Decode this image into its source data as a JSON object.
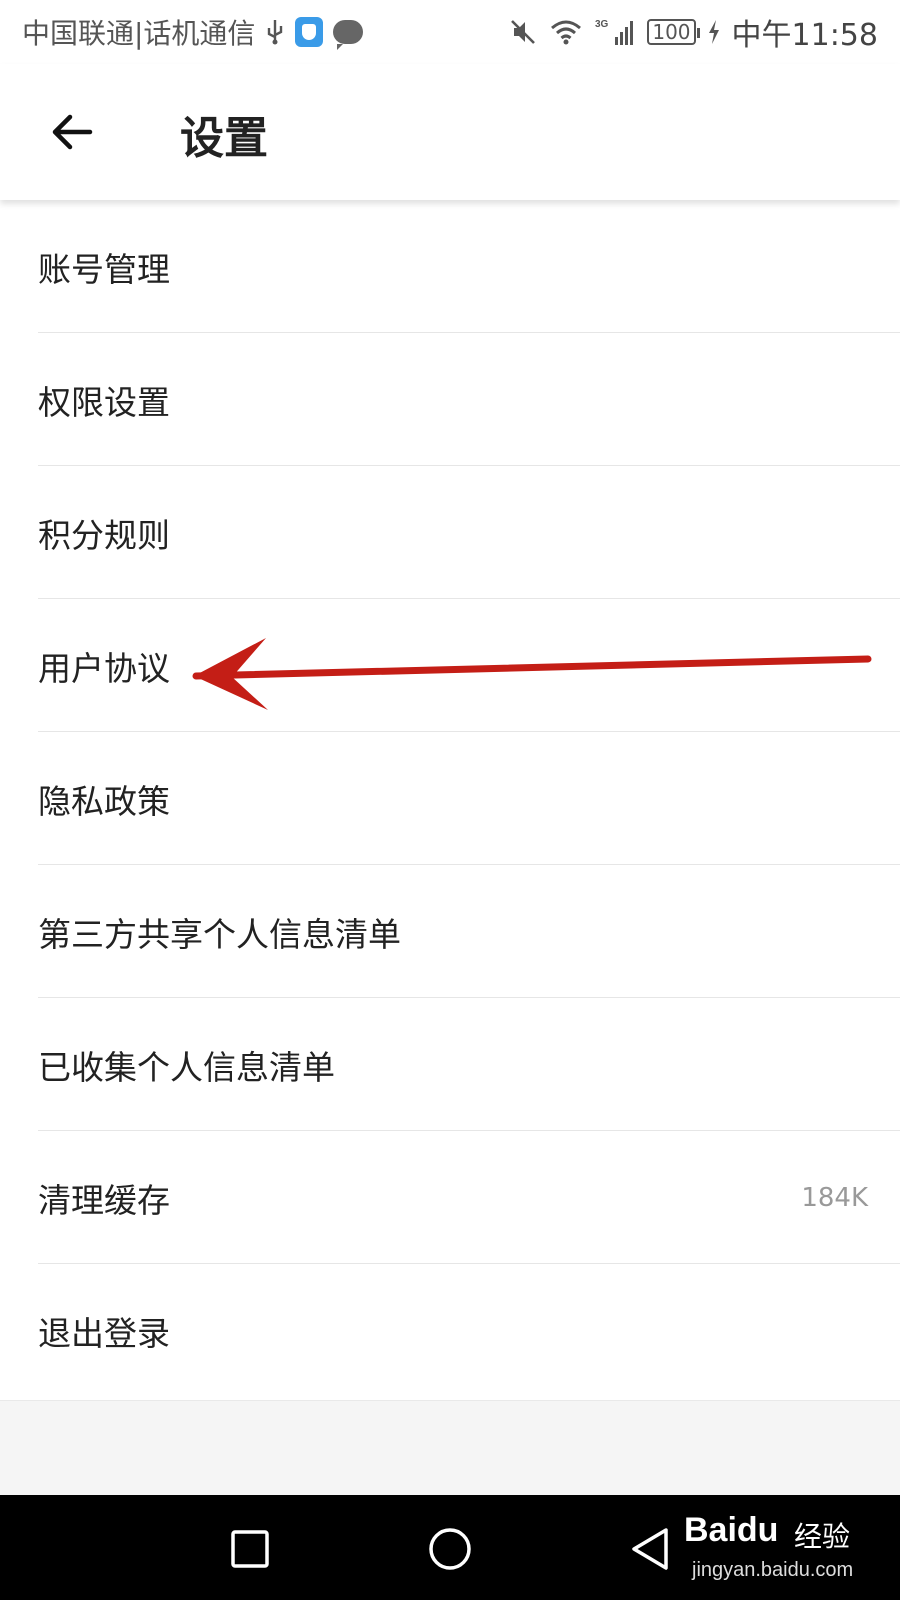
{
  "status_bar": {
    "carrier": "中国联通|话机通信",
    "network_label": "3G",
    "battery": "100",
    "time": "中午11:58",
    "icons": [
      "usb-icon",
      "shield-app-icon",
      "chat-icon",
      "mute-icon",
      "wifi-icon",
      "signal-icon",
      "battery-icon",
      "charging-icon"
    ]
  },
  "header": {
    "title": "设置",
    "back_icon": "arrow-left-icon"
  },
  "settings": {
    "items": [
      {
        "label": "账号管理",
        "value": ""
      },
      {
        "label": "权限设置",
        "value": ""
      },
      {
        "label": "积分规则",
        "value": ""
      },
      {
        "label": "用户协议",
        "value": ""
      },
      {
        "label": "隐私政策",
        "value": ""
      },
      {
        "label": "第三方共享个人信息清单",
        "value": ""
      },
      {
        "label": "已收集个人信息清单",
        "value": ""
      },
      {
        "label": "清理缓存",
        "value": "184K"
      },
      {
        "label": "退出登录",
        "value": ""
      }
    ]
  },
  "annotation": {
    "color": "#c41e16",
    "points_to": "用户协议"
  },
  "nav_bar": {
    "icons": [
      "recent-apps-icon",
      "home-icon",
      "back-triangle-icon"
    ]
  },
  "watermark": {
    "logo": "Baidu",
    "brand": "经验",
    "url": "jingyan.baidu.com"
  },
  "colors": {
    "background": "#ffffff",
    "text": "#222222",
    "divider": "#e6e6e6",
    "secondary_text": "#999999",
    "nav_bar": "#000000"
  }
}
